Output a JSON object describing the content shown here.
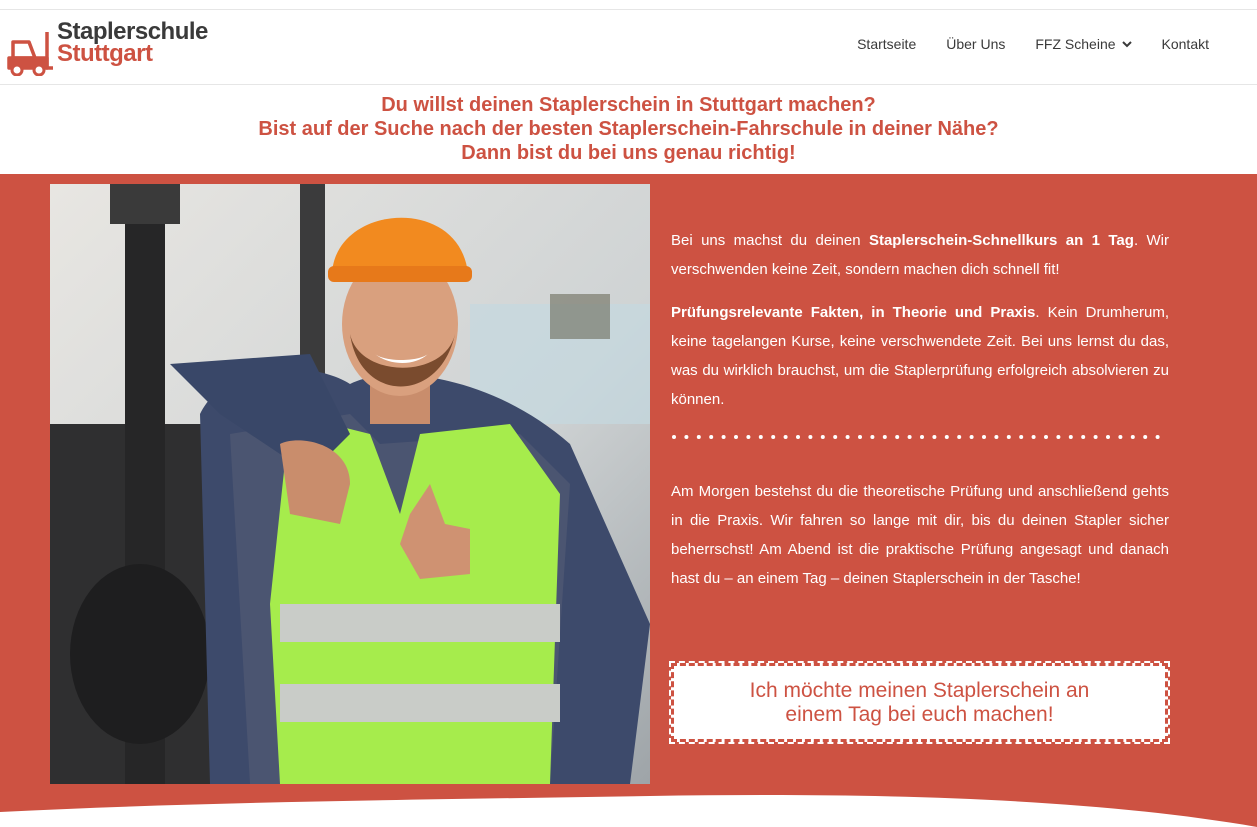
{
  "brand": {
    "line1": "Staplerschule",
    "line2": "Stuttgart",
    "accent_color": "#cd5242",
    "logo_icon": "forklift-icon"
  },
  "nav": {
    "items": [
      {
        "label": "Startseite"
      },
      {
        "label": "Über Uns"
      },
      {
        "label": "FFZ Scheine",
        "has_dropdown": true
      },
      {
        "label": "Kontakt"
      }
    ]
  },
  "headline": {
    "line1": "Du willst deinen Staplerschein in Stuttgart machen?",
    "line2": "Bist auf der Suche nach der besten Staplerschein-Fahrschule in deiner Nähe?",
    "line3": "Dann bist du bei uns genau richtig!"
  },
  "content": {
    "p1_pre": "Bei uns machst du deinen ",
    "p1_bold": "Staplerschein-Schnellkurs an 1 Tag",
    "p1_post": ". Wir verschwenden keine Zeit, sondern machen dich schnell fit!",
    "p2_bold": "Prüfungsrelevante Fakten, in Theorie und Praxis",
    "p2_post": ". Kein Drumherum, keine tagelangen Kurse, keine verschwendete Zeit. Bei uns lernst du das, was du wirklich brauchst, um die Staplerprüfung erfolgreich absolvieren zu können.",
    "p3": "Am Morgen bestehst du die theoretische Prüfung und anschließend gehts in die Praxis. Wir fahren so lange mit dir, bis du deinen Stapler sicher beherrschst! Am Abend ist die praktische Prüfung angesagt und danach hast du – an einem Tag – deinen Staplerschein in der Tasche!"
  },
  "cta": {
    "line1": "Ich möchte meinen Staplerschein an",
    "line2": "einem Tag bei euch machen!"
  }
}
